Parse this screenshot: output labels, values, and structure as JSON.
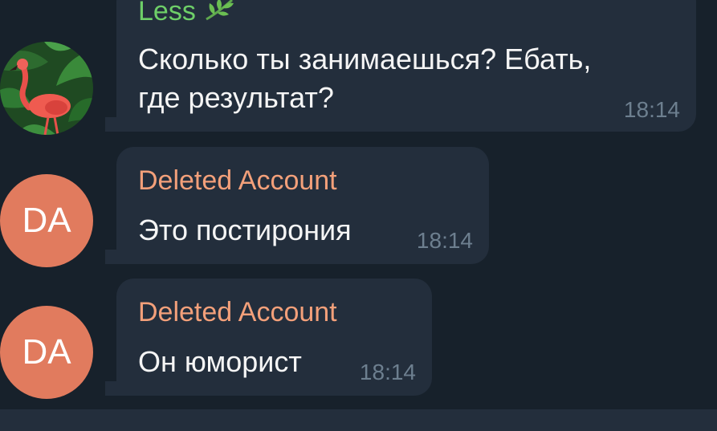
{
  "colors": {
    "background": "#17212b",
    "bubble": "#232e3c",
    "sender_less": "#6ecf68",
    "sender_deleted": "#f3a07a",
    "avatar_deleted": "#e17b5e",
    "timestamp": "#6d7f8f"
  },
  "messages": [
    {
      "sender": "Less",
      "sender_icon": "leaf-emoji-icon",
      "text_line1": "Сколько ты занимаешься? Ебать,",
      "text_line2": "где результат?",
      "time": "18:14",
      "avatar": "flamingo-avatar"
    },
    {
      "sender": "Deleted Account",
      "text": "Это постирония",
      "time": "18:14",
      "avatar_initials": "DA"
    },
    {
      "sender": "Deleted Account",
      "text": "Он юморист",
      "time": "18:14",
      "avatar_initials": "DA"
    }
  ]
}
